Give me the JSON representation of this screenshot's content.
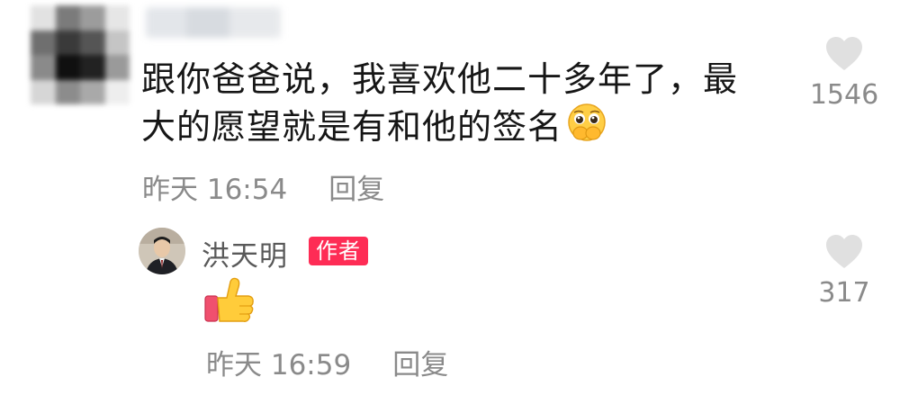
{
  "comment": {
    "text": "跟你爸爸说，我喜欢他二十多年了，最大的愿望就是有和他的签名",
    "emoji": "pleading-face-hands-over-mouth",
    "time": "昨天 16:54",
    "reply_label": "回复",
    "likes": "1546"
  },
  "reply": {
    "author_name": "洪天明",
    "author_badge": "作者",
    "emoji": "thumbs-up",
    "time": "昨天 16:59",
    "reply_label": "回复",
    "likes": "317"
  },
  "colors": {
    "text": "#161616",
    "meta": "#8a8a8a",
    "badge": "#fe2c55",
    "heart": "#e0e0e0"
  }
}
